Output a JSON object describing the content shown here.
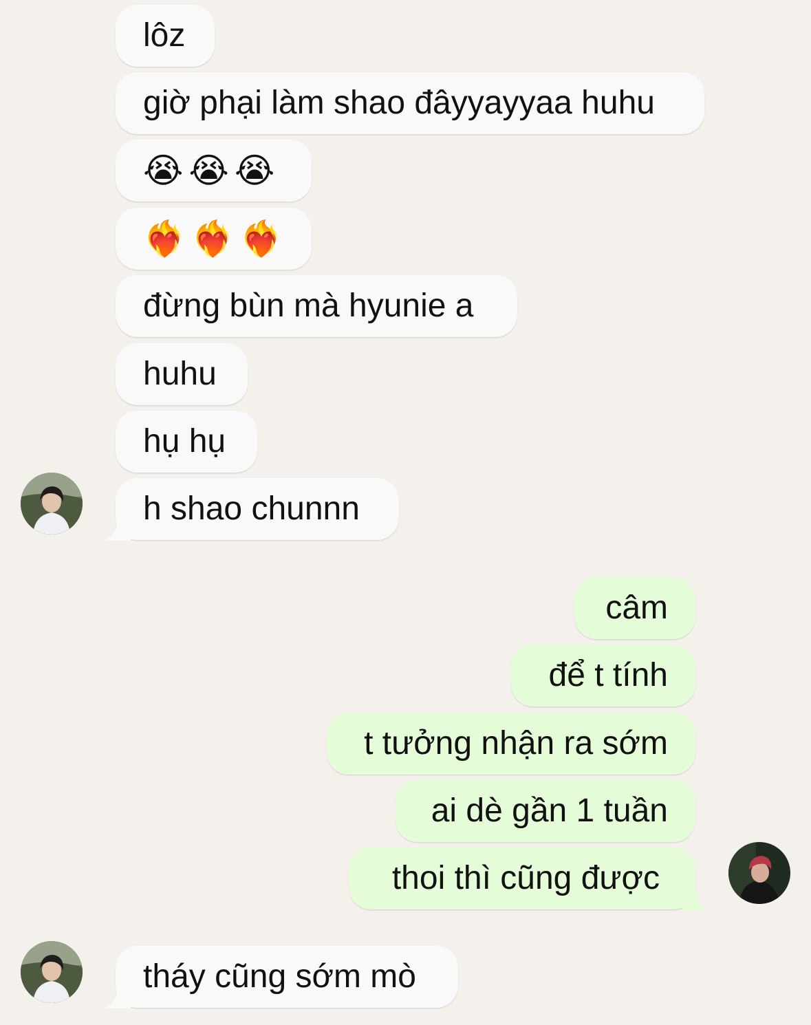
{
  "colors": {
    "background": "#f4f1ec",
    "incoming_bubble": "#f9f9f9",
    "outgoing_bubble": "#e4fcd8"
  },
  "incoming_1": [
    {
      "text": "lôz"
    },
    {
      "text": "giờ phại làm shao đâyyayyaa huhu"
    },
    {
      "text": "😭😭😭"
    },
    {
      "text": "❤️‍🔥❤️‍🔥❤️‍🔥"
    },
    {
      "text": "đừng bùn mà hyunie a"
    },
    {
      "text": "huhu"
    },
    {
      "text": "hụ hụ"
    },
    {
      "text": "h shao chunnn"
    }
  ],
  "outgoing_1": [
    {
      "text": "câm"
    },
    {
      "text": "để t tính"
    },
    {
      "text": "t tưởng nhận ra sớm"
    },
    {
      "text": "ai dè gần 1 tuần"
    },
    {
      "text": "thoi thì cũng được"
    }
  ],
  "incoming_2": [
    {
      "text": "tháy cũng sớm mò"
    }
  ],
  "avatars": {
    "contact": "contact-avatar-photo",
    "self": "self-avatar-photo"
  }
}
